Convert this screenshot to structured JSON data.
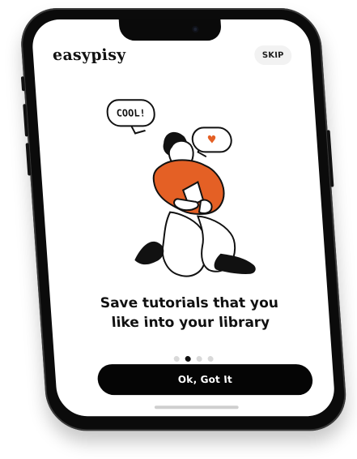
{
  "app": {
    "brand": "easypisy"
  },
  "header": {
    "skip_label": "SKIP"
  },
  "illustration": {
    "bubble_text": "COOL!",
    "bubble_icon": "heart-icon",
    "accent": "#e46025"
  },
  "onboarding": {
    "title_line_1": "Save tutorials that you",
    "title_line_2": "like into your library",
    "active_page": 2,
    "page_count": 4
  },
  "footer": {
    "cta_label": "Ok, Got It"
  }
}
